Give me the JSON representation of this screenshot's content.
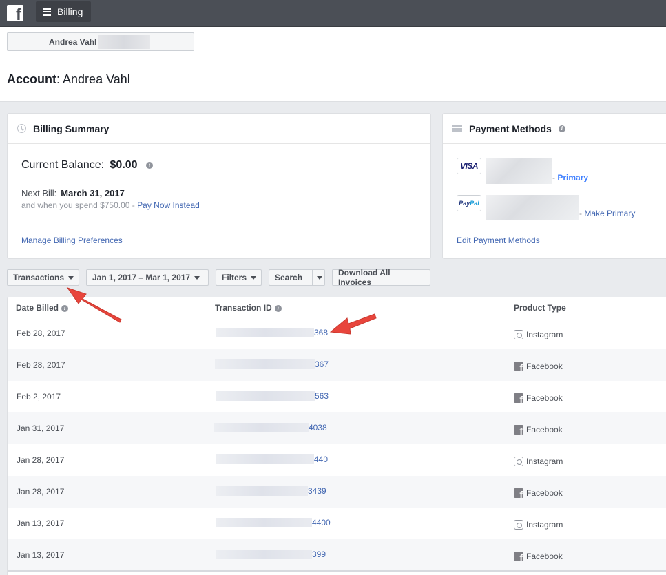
{
  "topbar": {
    "logo_icon": "facebook-logo-icon",
    "menu_icon": "hamburger-icon",
    "menu_label": "Billing"
  },
  "account_selector": {
    "value": "Andrea Vahl"
  },
  "account_header": {
    "label": "Account",
    "separator": ":",
    "name": "Andrea Vahl"
  },
  "billing_summary": {
    "icon": "clock-icon",
    "title": "Billing Summary",
    "balance_label": "Current Balance:",
    "balance_value": "$0.00",
    "next_bill_label": "Next Bill:",
    "next_bill_date": "March 31, 2017",
    "spend_text": "and when you spend $750.00 - ",
    "pay_now_link": "Pay Now Instead",
    "manage_link": "Manage Billing Preferences"
  },
  "payment_methods": {
    "icon": "credit-card-icon",
    "title": "Payment Methods",
    "methods": [
      {
        "brand": "VISA",
        "suffix_sep": "- ",
        "status": "Primary"
      },
      {
        "brand_a": "Pay",
        "brand_b": "Pal",
        "suffix_sep": "- ",
        "action": "Make Primary"
      }
    ],
    "edit_link": "Edit Payment Methods"
  },
  "toolbar": {
    "view_select": "Transactions",
    "date_range": "Jan 1, 2017 – Mar 1, 2017",
    "filters": "Filters",
    "search": "Search",
    "download": "Download All Invoices"
  },
  "table": {
    "columns": [
      "Date Billed",
      "Transaction ID",
      "Product Type"
    ],
    "rows": [
      {
        "date": "Feb 28, 2017",
        "txn_visible": "368",
        "product": "Instagram"
      },
      {
        "date": "Feb 28, 2017",
        "txn_visible": "367",
        "product": "Facebook"
      },
      {
        "date": "Feb 2, 2017",
        "txn_visible": "563",
        "product": "Facebook"
      },
      {
        "date": "Jan 31, 2017",
        "txn_visible": "4038",
        "product": "Facebook"
      },
      {
        "date": "Jan 28, 2017",
        "txn_visible": "440",
        "product": "Instagram"
      },
      {
        "date": "Jan 28, 2017",
        "txn_visible": "3439",
        "product": "Facebook"
      },
      {
        "date": "Jan 13, 2017",
        "txn_visible": "4400",
        "product": "Instagram"
      },
      {
        "date": "Jan 13, 2017",
        "txn_visible": "399",
        "product": "Facebook"
      }
    ]
  },
  "colors": {
    "topbar": "#4b4f56",
    "link": "#4267b2",
    "primary": "#4080ff",
    "annotation_arrow": "#e8453c"
  }
}
